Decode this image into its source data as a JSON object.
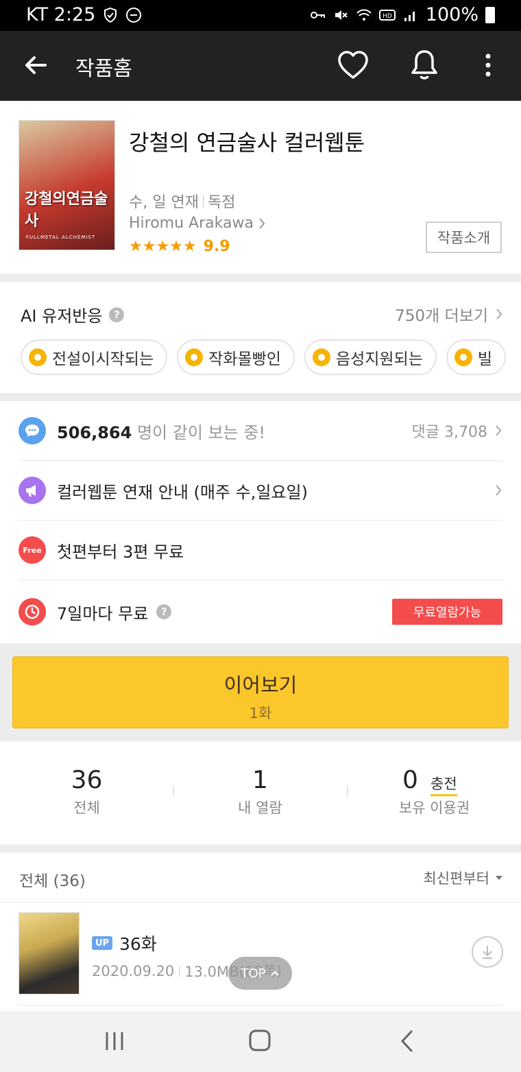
{
  "status_bar": {
    "carrier_time": "KT 2:25",
    "battery": "100%"
  },
  "app_bar": {
    "title": "작품홈"
  },
  "work": {
    "title": "강철의 연금술사 컬러웹툰",
    "schedule": "수, 일 연재",
    "exclusive": "독점",
    "author": "Hiromu Arakawa",
    "stars": "★★★★★",
    "rating": "9.9",
    "intro_button": "작품소개",
    "cover": {
      "title_art": "강철의연금술사",
      "subtitle_art": "FULLMETAL ALCHEMIST"
    }
  },
  "ai_reaction": {
    "label": "AI 유저반응",
    "more": "750개 더보기",
    "chips": [
      "전설이시작되는",
      "작화몰빵인",
      "음성지원되는",
      "빌"
    ]
  },
  "info_rows": {
    "viewers_count": "506,864",
    "viewers_text": "명이 같이 보는 중!",
    "comments": "댓글 3,708",
    "notice": "컬러웹툰 연재 안내 (매주 수,일요일)",
    "free_first_icon": "Free",
    "free_first": "첫편부터 3편 무료",
    "wait_free": "7일마다 무료",
    "wait_free_badge": "무료열람가능"
  },
  "continue_button": {
    "label": "이어보기",
    "episode": "1화"
  },
  "stats": {
    "total_value": "36",
    "total_label": "전체",
    "read_value": "1",
    "read_label": "내 열람",
    "tickets_value": "0",
    "tickets_label": "보유 이용권",
    "charge_label": "충전"
  },
  "episode_list": {
    "header": "전체 (36)",
    "sort": "최신편부터",
    "items": [
      {
        "badge": "UP",
        "title": "36화",
        "date": "2020.09.20",
        "size": "13.0MB(68쪽)"
      }
    ]
  },
  "top_button": "TOP",
  "colors": {
    "app_bar": "#222222",
    "continue_button": "#fcc72a",
    "rating": "#f59b00",
    "free_badge": "#f34c4c",
    "up_badge": "#6aa5ee"
  }
}
